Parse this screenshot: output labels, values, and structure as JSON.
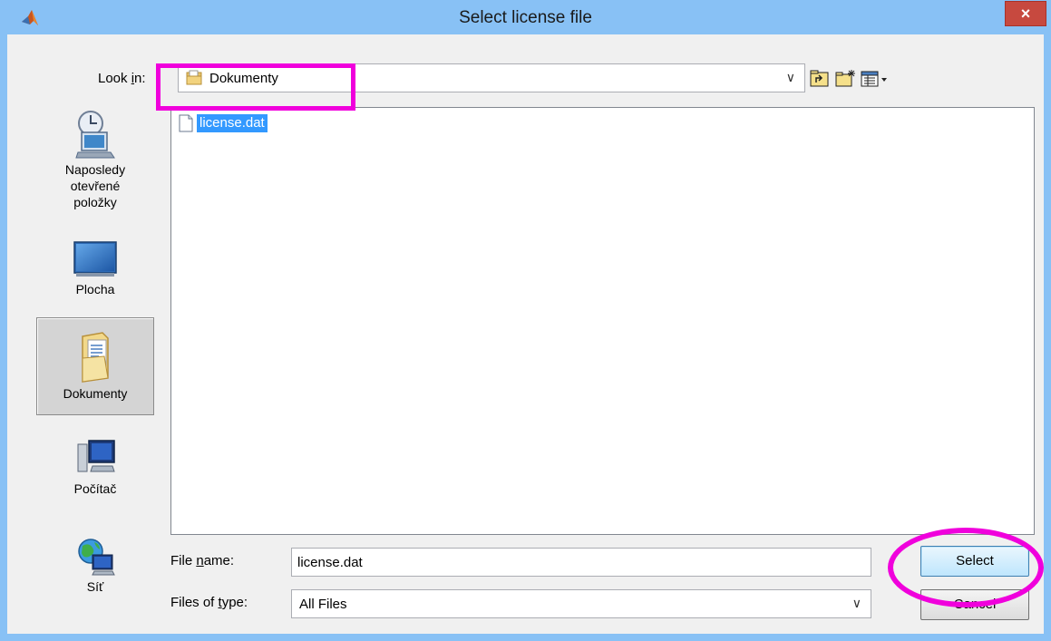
{
  "window": {
    "title": "Select license file",
    "close_label": "×"
  },
  "lookin": {
    "label_pre": "Look ",
    "label_key": "i",
    "label_post": "n:",
    "value": "Dokumenty"
  },
  "places": [
    {
      "label_lines": [
        "Naposledy",
        "otevřené",
        "položky"
      ],
      "icon": "recent-items-icon"
    },
    {
      "label_lines": [
        "Plocha"
      ],
      "icon": "desktop-icon"
    },
    {
      "label_lines": [
        "Dokumenty"
      ],
      "icon": "documents-icon",
      "selected": true
    },
    {
      "label_lines": [
        "Počítač"
      ],
      "icon": "computer-icon"
    },
    {
      "label_lines": [
        "Síť"
      ],
      "icon": "network-icon"
    }
  ],
  "files": [
    {
      "name": "license.dat",
      "selected": true
    }
  ],
  "filename": {
    "label_pre": "File ",
    "label_key": "n",
    "label_post": "ame:",
    "value": "license.dat"
  },
  "filetype": {
    "label_pre": "Files of ",
    "label_key": "t",
    "label_post": "ype:",
    "value": "All Files"
  },
  "buttons": {
    "select": "Select",
    "cancel": "Cancel"
  },
  "colors": {
    "titlebar": "#88c1f5",
    "highlight": "#f000dc",
    "selection": "#3399ff",
    "close": "#c7493f"
  }
}
